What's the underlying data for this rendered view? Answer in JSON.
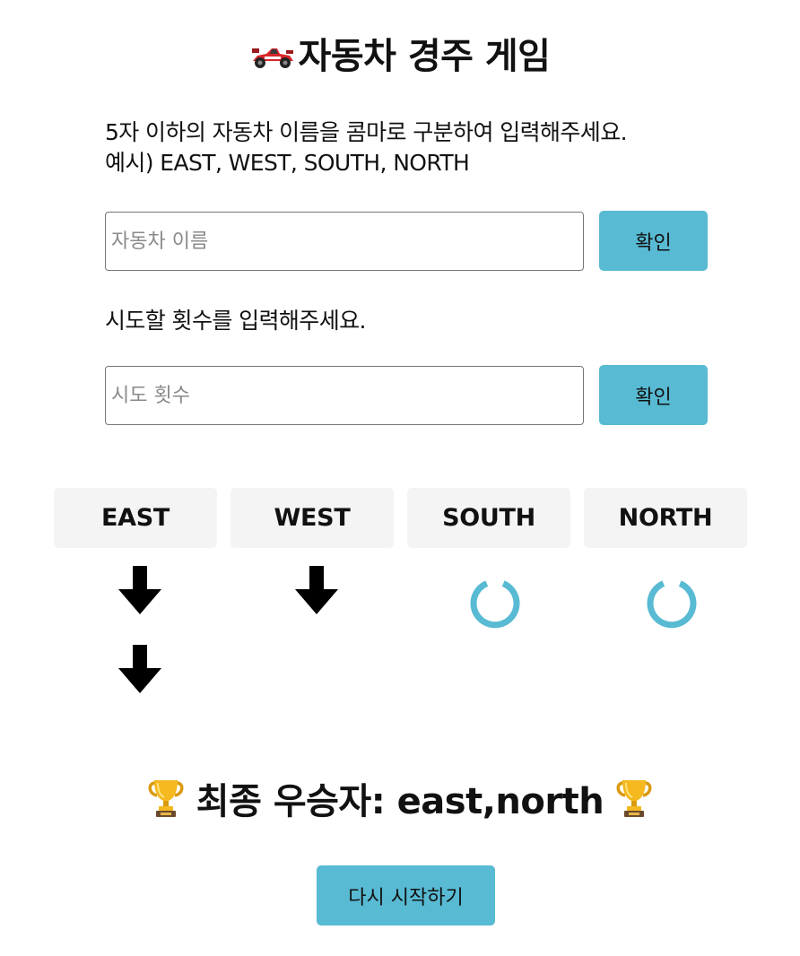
{
  "header": {
    "title": "자동차 경주 게임",
    "icon": "racing-car-icon"
  },
  "names_section": {
    "instruction_line1": "5자 이하의 자동차 이름을 콤마로 구분하여 입력해주세요.",
    "instruction_line2": "예시) EAST, WEST, SOUTH, NORTH",
    "input_value": "",
    "input_placeholder": "자동차 이름",
    "confirm_label": "확인"
  },
  "count_section": {
    "instruction": "시도할 횟수를 입력해주세요.",
    "input_value": "",
    "input_placeholder": "시도 횟수",
    "confirm_label": "확인"
  },
  "cars": [
    {
      "name": "EAST",
      "moves": 2,
      "status": "done",
      "indicator_icon": "arrow-down-icon"
    },
    {
      "name": "WEST",
      "moves": 1,
      "status": "done",
      "indicator_icon": "arrow-down-icon"
    },
    {
      "name": "SOUTH",
      "moves": 0,
      "status": "loading",
      "indicator_icon": "spinner-icon"
    },
    {
      "name": "NORTH",
      "moves": 0,
      "status": "loading",
      "indicator_icon": "spinner-icon"
    }
  ],
  "result": {
    "prefix": "최종 우승자:",
    "winners": "east,north",
    "icon": "trophy-icon"
  },
  "restart_label": "다시 시작하기",
  "colors": {
    "accent": "#58bad3",
    "car_card_bg": "#f4f4f4",
    "arrow": "#000000",
    "spinner": "#58bad3"
  }
}
